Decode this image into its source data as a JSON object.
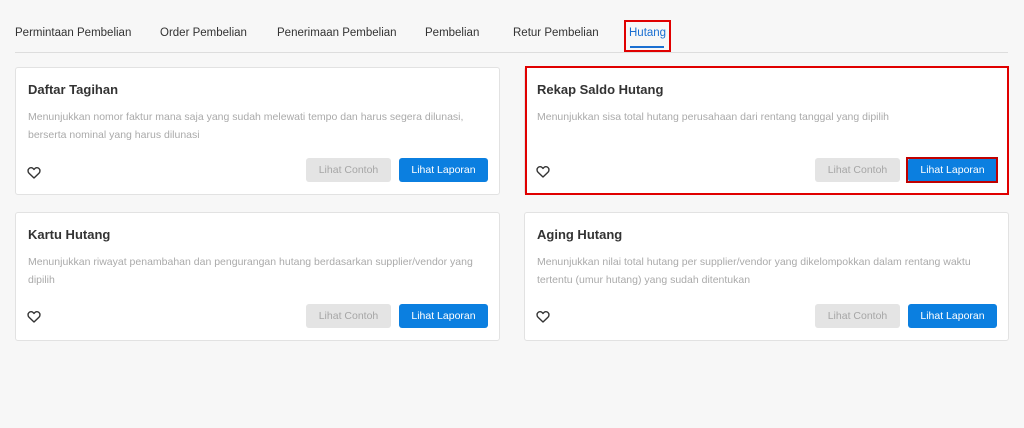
{
  "tabs": [
    {
      "label": "Permintaan Pembelian"
    },
    {
      "label": "Order Pembelian"
    },
    {
      "label": "Penerimaan Pembelian"
    },
    {
      "label": "Pembelian"
    },
    {
      "label": "Retur Pembelian"
    },
    {
      "label": "Hutang",
      "active": true
    }
  ],
  "cards": [
    {
      "title": "Daftar Tagihan",
      "description": "Menunjukkan nomor faktur mana saja yang sudah melewati tempo dan harus segera dilunasi, berserta nominal yang harus dilunasi",
      "example_label": "Lihat Contoh",
      "report_label": "Lihat Laporan"
    },
    {
      "title": "Rekap Saldo Hutang",
      "description": "Menunjukkan sisa total hutang perusahaan dari rentang tanggal yang dipilih",
      "example_label": "Lihat Contoh",
      "report_label": "Lihat Laporan"
    },
    {
      "title": "Kartu Hutang",
      "description": "Menunjukkan riwayat penambahan dan pengurangan hutang berdasarkan supplier/vendor yang dipilih",
      "example_label": "Lihat Contoh",
      "report_label": "Lihat Laporan"
    },
    {
      "title": "Aging Hutang",
      "description": "Menunjukkan nilai total hutang per supplier/vendor yang dikelompokkan dalam rentang waktu tertentu (umur hutang) yang sudah ditentukan",
      "example_label": "Lihat Contoh",
      "report_label": "Lihat Laporan"
    }
  ],
  "colors": {
    "accent": "#0b7fe0",
    "active_tab": "#1a6fd1",
    "highlight": "#e00000",
    "disabled_button": "#e4e4e4"
  },
  "icons": {
    "favorite": "heart-outline-icon"
  }
}
